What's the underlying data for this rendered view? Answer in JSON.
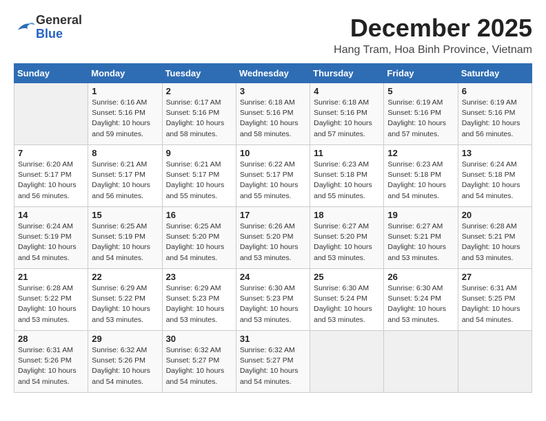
{
  "header": {
    "logo_general": "General",
    "logo_blue": "Blue",
    "month_title": "December 2025",
    "location": "Hang Tram, Hoa Binh Province, Vietnam"
  },
  "days_of_week": [
    "Sunday",
    "Monday",
    "Tuesday",
    "Wednesday",
    "Thursday",
    "Friday",
    "Saturday"
  ],
  "weeks": [
    [
      {
        "day": "",
        "info": ""
      },
      {
        "day": "1",
        "info": "Sunrise: 6:16 AM\nSunset: 5:16 PM\nDaylight: 10 hours\nand 59 minutes."
      },
      {
        "day": "2",
        "info": "Sunrise: 6:17 AM\nSunset: 5:16 PM\nDaylight: 10 hours\nand 58 minutes."
      },
      {
        "day": "3",
        "info": "Sunrise: 6:18 AM\nSunset: 5:16 PM\nDaylight: 10 hours\nand 58 minutes."
      },
      {
        "day": "4",
        "info": "Sunrise: 6:18 AM\nSunset: 5:16 PM\nDaylight: 10 hours\nand 57 minutes."
      },
      {
        "day": "5",
        "info": "Sunrise: 6:19 AM\nSunset: 5:16 PM\nDaylight: 10 hours\nand 57 minutes."
      },
      {
        "day": "6",
        "info": "Sunrise: 6:19 AM\nSunset: 5:16 PM\nDaylight: 10 hours\nand 56 minutes."
      }
    ],
    [
      {
        "day": "7",
        "info": "Sunrise: 6:20 AM\nSunset: 5:17 PM\nDaylight: 10 hours\nand 56 minutes."
      },
      {
        "day": "8",
        "info": "Sunrise: 6:21 AM\nSunset: 5:17 PM\nDaylight: 10 hours\nand 56 minutes."
      },
      {
        "day": "9",
        "info": "Sunrise: 6:21 AM\nSunset: 5:17 PM\nDaylight: 10 hours\nand 55 minutes."
      },
      {
        "day": "10",
        "info": "Sunrise: 6:22 AM\nSunset: 5:17 PM\nDaylight: 10 hours\nand 55 minutes."
      },
      {
        "day": "11",
        "info": "Sunrise: 6:23 AM\nSunset: 5:18 PM\nDaylight: 10 hours\nand 55 minutes."
      },
      {
        "day": "12",
        "info": "Sunrise: 6:23 AM\nSunset: 5:18 PM\nDaylight: 10 hours\nand 54 minutes."
      },
      {
        "day": "13",
        "info": "Sunrise: 6:24 AM\nSunset: 5:18 PM\nDaylight: 10 hours\nand 54 minutes."
      }
    ],
    [
      {
        "day": "14",
        "info": "Sunrise: 6:24 AM\nSunset: 5:19 PM\nDaylight: 10 hours\nand 54 minutes."
      },
      {
        "day": "15",
        "info": "Sunrise: 6:25 AM\nSunset: 5:19 PM\nDaylight: 10 hours\nand 54 minutes."
      },
      {
        "day": "16",
        "info": "Sunrise: 6:25 AM\nSunset: 5:20 PM\nDaylight: 10 hours\nand 54 minutes."
      },
      {
        "day": "17",
        "info": "Sunrise: 6:26 AM\nSunset: 5:20 PM\nDaylight: 10 hours\nand 53 minutes."
      },
      {
        "day": "18",
        "info": "Sunrise: 6:27 AM\nSunset: 5:20 PM\nDaylight: 10 hours\nand 53 minutes."
      },
      {
        "day": "19",
        "info": "Sunrise: 6:27 AM\nSunset: 5:21 PM\nDaylight: 10 hours\nand 53 minutes."
      },
      {
        "day": "20",
        "info": "Sunrise: 6:28 AM\nSunset: 5:21 PM\nDaylight: 10 hours\nand 53 minutes."
      }
    ],
    [
      {
        "day": "21",
        "info": "Sunrise: 6:28 AM\nSunset: 5:22 PM\nDaylight: 10 hours\nand 53 minutes."
      },
      {
        "day": "22",
        "info": "Sunrise: 6:29 AM\nSunset: 5:22 PM\nDaylight: 10 hours\nand 53 minutes."
      },
      {
        "day": "23",
        "info": "Sunrise: 6:29 AM\nSunset: 5:23 PM\nDaylight: 10 hours\nand 53 minutes."
      },
      {
        "day": "24",
        "info": "Sunrise: 6:30 AM\nSunset: 5:23 PM\nDaylight: 10 hours\nand 53 minutes."
      },
      {
        "day": "25",
        "info": "Sunrise: 6:30 AM\nSunset: 5:24 PM\nDaylight: 10 hours\nand 53 minutes."
      },
      {
        "day": "26",
        "info": "Sunrise: 6:30 AM\nSunset: 5:24 PM\nDaylight: 10 hours\nand 53 minutes."
      },
      {
        "day": "27",
        "info": "Sunrise: 6:31 AM\nSunset: 5:25 PM\nDaylight: 10 hours\nand 54 minutes."
      }
    ],
    [
      {
        "day": "28",
        "info": "Sunrise: 6:31 AM\nSunset: 5:26 PM\nDaylight: 10 hours\nand 54 minutes."
      },
      {
        "day": "29",
        "info": "Sunrise: 6:32 AM\nSunset: 5:26 PM\nDaylight: 10 hours\nand 54 minutes."
      },
      {
        "day": "30",
        "info": "Sunrise: 6:32 AM\nSunset: 5:27 PM\nDaylight: 10 hours\nand 54 minutes."
      },
      {
        "day": "31",
        "info": "Sunrise: 6:32 AM\nSunset: 5:27 PM\nDaylight: 10 hours\nand 54 minutes."
      },
      {
        "day": "",
        "info": ""
      },
      {
        "day": "",
        "info": ""
      },
      {
        "day": "",
        "info": ""
      }
    ]
  ]
}
